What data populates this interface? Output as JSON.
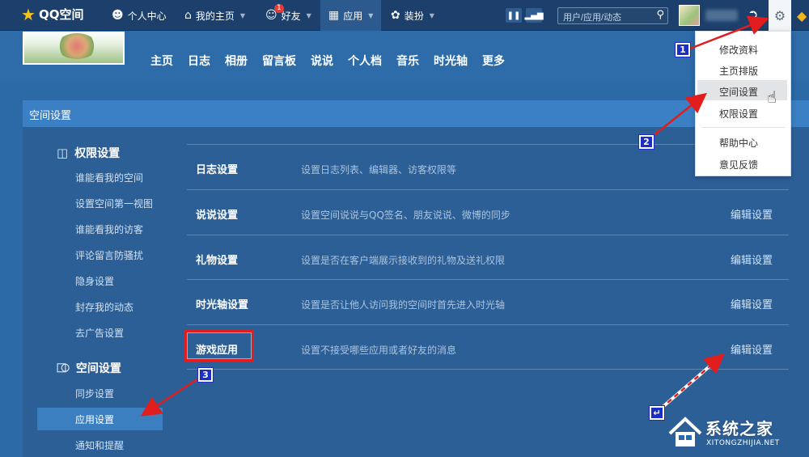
{
  "topbar": {
    "logo": "QQ空间",
    "nav": [
      {
        "label": "个人中心",
        "icon": "user-icon"
      },
      {
        "label": "我的主页",
        "icon": "home-icon"
      },
      {
        "label": "好友",
        "icon": "friends-icon",
        "badge": "1"
      },
      {
        "label": "应用",
        "icon": "grid-icon"
      },
      {
        "label": "装扮",
        "icon": "shirt-icon"
      }
    ],
    "search_placeholder": "用户/应用/动态"
  },
  "profile_menu": [
    "主页",
    "日志",
    "相册",
    "留言板",
    "说说",
    "个人档",
    "音乐",
    "时光轴",
    "更多"
  ],
  "dropdown": {
    "items": [
      "修改资料",
      "主页排版",
      "空间设置",
      "权限设置",
      "帮助中心",
      "意见反馈"
    ],
    "hovered": "空间设置"
  },
  "card": {
    "title": "空间设置"
  },
  "sidebar": {
    "group1": {
      "title": "权限设置",
      "items": [
        "谁能看我的空间",
        "设置空间第一视图",
        "谁能看我的访客",
        "评论留言防骚扰",
        "隐身设置",
        "封存我的动态",
        "去广告设置"
      ]
    },
    "group2": {
      "title": "空间设置",
      "items": [
        "同步设置",
        "应用设置",
        "通知和提醒"
      ],
      "selected": "应用设置"
    }
  },
  "rows": [
    {
      "name": "日志设置",
      "desc": "设置日志列表、编辑器、访客权限等",
      "edit": ""
    },
    {
      "name": "说说设置",
      "desc": "设置空间说说与QQ签名、朋友说说、微博的同步",
      "edit": "编辑设置"
    },
    {
      "name": "礼物设置",
      "desc": "设置是否在客户端展示接收到的礼物及送礼权限",
      "edit": "编辑设置"
    },
    {
      "name": "时光轴设置",
      "desc": "设置是否让他人访问我的空间时首先进入时光轴",
      "edit": "编辑设置"
    },
    {
      "name": "游戏应用",
      "desc": "设置不接受哪些应用或者好友的消息",
      "edit": "编辑设置"
    }
  ],
  "annotations": {
    "steps": [
      "1",
      "2",
      "3"
    ],
    "arrow_color": "#e11d1d"
  },
  "watermark": {
    "title": "系统之家",
    "subtitle": "XITONGZHIJIA.NET"
  }
}
